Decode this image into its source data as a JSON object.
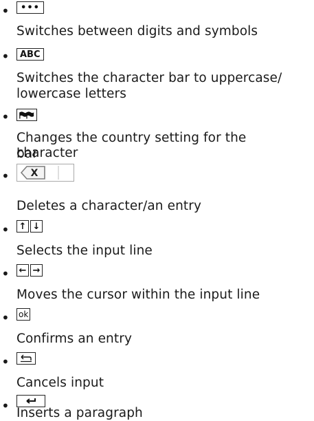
{
  "items": [
    {
      "key": "•••",
      "key_icon": "three-dots-symbol-key",
      "description": "Switches between digits and symbols"
    },
    {
      "key": "ABC",
      "key_icon": "abc-case-key",
      "description": "Switches the character bar to uppercase/",
      "description_2": "lowercase letters"
    },
    {
      "key_icon": "country-flags-key",
      "description": "Changes the country setting for the character",
      "description_2": "bar"
    },
    {
      "key_icon": "delete-backspace-key",
      "description": "Deletes a character/an entry"
    },
    {
      "keys": [
        "↑",
        "↓"
      ],
      "key_icon": "up-down-arrow-keys",
      "description": "Selects the input line"
    },
    {
      "keys": [
        "←",
        "→"
      ],
      "key_icon": "left-right-arrow-keys",
      "description": "Moves the cursor within the input line"
    },
    {
      "key": "ok",
      "key_icon": "ok-key",
      "description": "Confirms an entry"
    },
    {
      "key_icon": "back-return-key",
      "description": "Cancels input"
    },
    {
      "key_icon": "enter-key",
      "description": "Inserts a paragraph"
    }
  ]
}
